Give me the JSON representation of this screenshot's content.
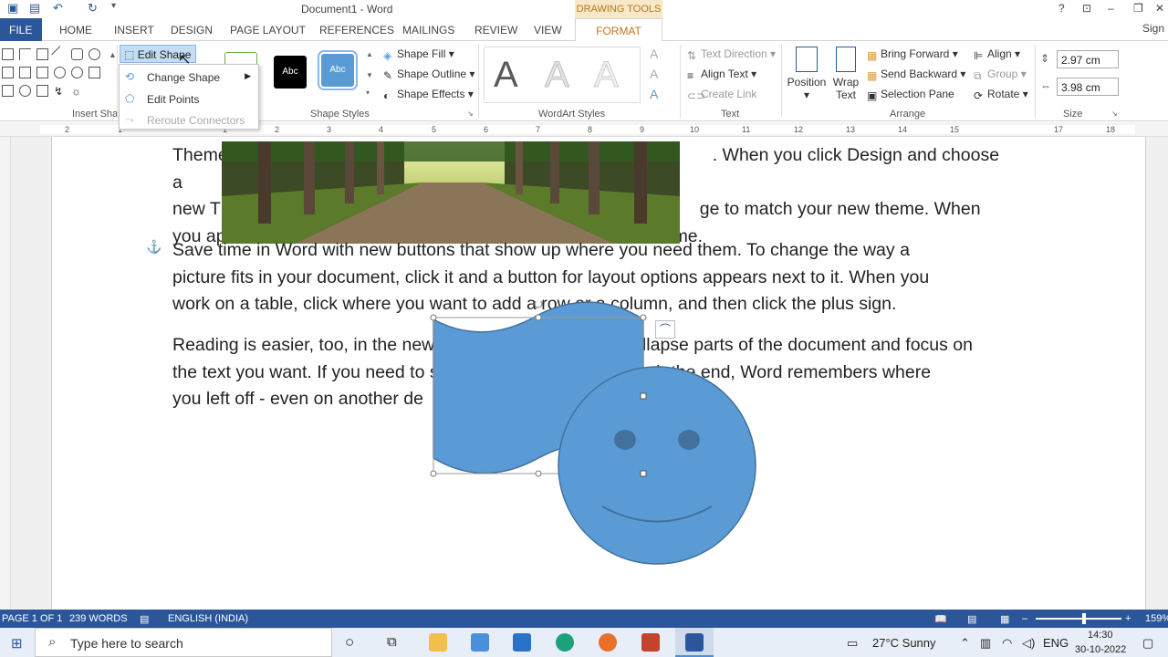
{
  "title_bar": {
    "doc_title": "Document1 - Word",
    "drawing_tools": "DRAWING TOOLS",
    "help": "?"
  },
  "tabs": [
    "FILE",
    "HOME",
    "INSERT",
    "DESIGN",
    "PAGE LAYOUT",
    "REFERENCES",
    "MAILINGS",
    "REVIEW",
    "VIEW",
    "FORMAT"
  ],
  "signin": "Sign",
  "ribbon": {
    "edit_shape": "Edit Shape",
    "menu": {
      "change_shape": "Change Shape",
      "edit_points": "Edit Points",
      "reroute": "Reroute Connectors"
    },
    "groups": {
      "insert_shapes": "Insert Shap",
      "shape_styles": "Shape Styles",
      "wordart": "WordArt Styles",
      "text": "Text",
      "arrange": "Arrange",
      "size": "Size"
    },
    "swatch_label": "Abc",
    "shape_fill": "Shape Fill",
    "shape_outline": "Shape Outline",
    "shape_effects": "Shape Effects",
    "wordart_letter": "A",
    "text_direction": "Text Direction",
    "align_text": "Align Text",
    "create_link": "Create Link",
    "position": "Position",
    "wrap_text": "Wrap Text",
    "bring_forward": "Bring Forward",
    "send_backward": "Send Backward",
    "selection_pane": "Selection Pane",
    "align": "Align",
    "group": "Group",
    "rotate": "Rotate",
    "height": "2.97 cm",
    "width": "3.98 cm"
  },
  "ruler_numbers": [
    "2",
    "1",
    "1",
    "2",
    "3",
    "4",
    "5",
    "6",
    "7",
    "8",
    "9",
    "10",
    "11",
    "12",
    "13",
    "14",
    "15",
    "17",
    "18"
  ],
  "document": {
    "para1": [
      "Theme",
      ". When you click Design and choose a",
      "new T",
      "ge to match your new theme. When",
      "you ap",
      "me."
    ],
    "para2": [
      "Save time in Word with new buttons that show up where you need them. To change the way a",
      "picture fits in your document, click it and a button for layout options appears next to it. When you",
      "work on a table, click where you want to add a row or a column, and then click the plus sign."
    ],
    "para3": [
      "Reading is easier, too, in the new Reading view. You can collapse parts of the document and focus on",
      "the text you want. If you need to stop reading before you reach the end, Word remembers where",
      "you left off - even on another de"
    ]
  },
  "status": {
    "page": "PAGE 1 OF 1",
    "words": "239 WORDS",
    "lang": "ENGLISH (INDIA)",
    "zoom": "159%"
  },
  "taskbar": {
    "search": "Type here to search",
    "weather": "27°C  Sunny",
    "lang": "ENG",
    "time": "14:30",
    "date": "30-10-2022"
  },
  "colors": {
    "accent": "#2b579a",
    "shape_fill": "#5b9bd5",
    "shape_stroke": "#41719c",
    "format_tab": "#c0741a"
  }
}
